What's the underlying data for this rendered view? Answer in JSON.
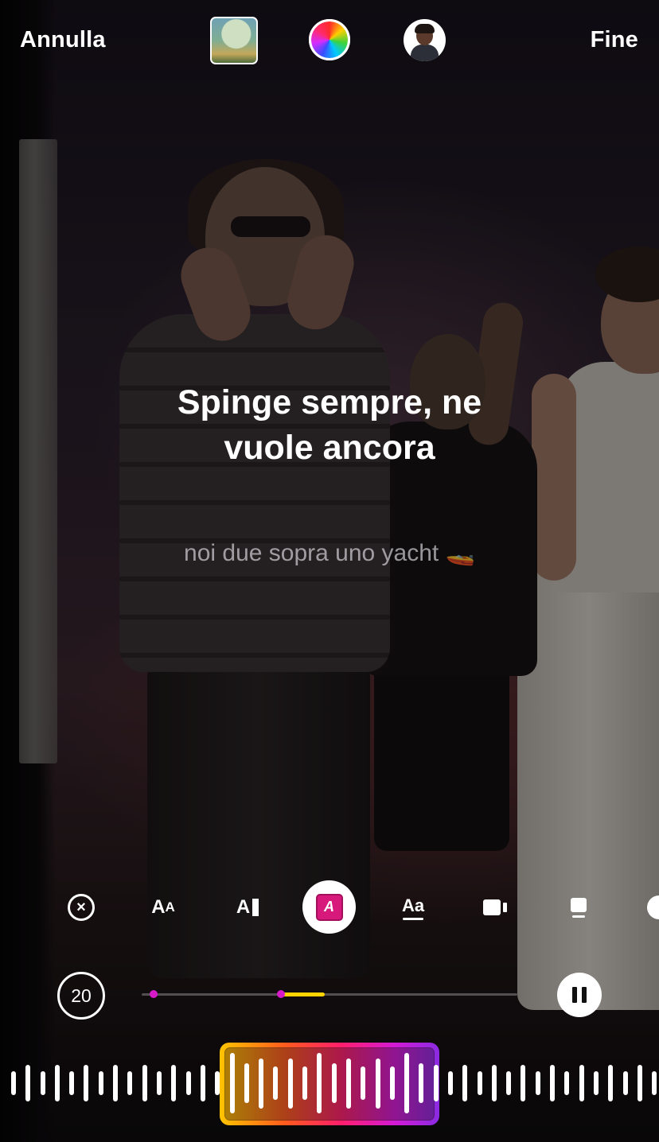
{
  "topbar": {
    "cancel_label": "Annulla",
    "done_label": "Fine",
    "thumbnail_icon": "album-cover-thumbnail",
    "color_icon": "color-wheel-icon",
    "avatar_icon": "avatar-icon"
  },
  "lyrics": {
    "current_line_1": "Spinge sempre, ne",
    "current_line_2": "vuole ancora",
    "next_line": "noi due sopra uno yacht 🚤"
  },
  "toolbar": {
    "close_glyph": "×",
    "text_size_big": "A",
    "text_size_small": "A",
    "align_glyph": "A",
    "active_style_glyph": "A",
    "font_glyph": "Aa",
    "active_color": "#d6197a",
    "icons": [
      "close-icon",
      "text-size-icon",
      "text-style-icon",
      "highlight-style-icon",
      "font-icon",
      "camera-icon",
      "lower-placement-icon",
      "more-icon"
    ]
  },
  "playback": {
    "duration": "20",
    "progress_fraction": 0.37,
    "segment_color": "#ffd400",
    "marker_color": "#d61ac8",
    "pause_icon": "pause-icon"
  },
  "waveform": {
    "selection_gradient": [
      "#ffc400",
      "#ff5a1e",
      "#ff1f6a",
      "#d21ad6",
      "#8a2be2"
    ]
  }
}
